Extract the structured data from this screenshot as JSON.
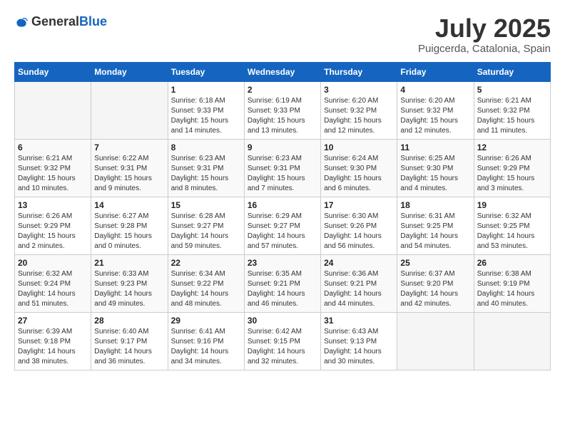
{
  "logo": {
    "text_general": "General",
    "text_blue": "Blue"
  },
  "header": {
    "month": "July 2025",
    "location": "Puigcerda, Catalonia, Spain"
  },
  "weekdays": [
    "Sunday",
    "Monday",
    "Tuesday",
    "Wednesday",
    "Thursday",
    "Friday",
    "Saturday"
  ],
  "weeks": [
    [
      {
        "day": "",
        "sunrise": "",
        "sunset": "",
        "daylight": ""
      },
      {
        "day": "",
        "sunrise": "",
        "sunset": "",
        "daylight": ""
      },
      {
        "day": "1",
        "sunrise": "Sunrise: 6:18 AM",
        "sunset": "Sunset: 9:33 PM",
        "daylight": "Daylight: 15 hours and 14 minutes."
      },
      {
        "day": "2",
        "sunrise": "Sunrise: 6:19 AM",
        "sunset": "Sunset: 9:33 PM",
        "daylight": "Daylight: 15 hours and 13 minutes."
      },
      {
        "day": "3",
        "sunrise": "Sunrise: 6:20 AM",
        "sunset": "Sunset: 9:32 PM",
        "daylight": "Daylight: 15 hours and 12 minutes."
      },
      {
        "day": "4",
        "sunrise": "Sunrise: 6:20 AM",
        "sunset": "Sunset: 9:32 PM",
        "daylight": "Daylight: 15 hours and 12 minutes."
      },
      {
        "day": "5",
        "sunrise": "Sunrise: 6:21 AM",
        "sunset": "Sunset: 9:32 PM",
        "daylight": "Daylight: 15 hours and 11 minutes."
      }
    ],
    [
      {
        "day": "6",
        "sunrise": "Sunrise: 6:21 AM",
        "sunset": "Sunset: 9:32 PM",
        "daylight": "Daylight: 15 hours and 10 minutes."
      },
      {
        "day": "7",
        "sunrise": "Sunrise: 6:22 AM",
        "sunset": "Sunset: 9:31 PM",
        "daylight": "Daylight: 15 hours and 9 minutes."
      },
      {
        "day": "8",
        "sunrise": "Sunrise: 6:23 AM",
        "sunset": "Sunset: 9:31 PM",
        "daylight": "Daylight: 15 hours and 8 minutes."
      },
      {
        "day": "9",
        "sunrise": "Sunrise: 6:23 AM",
        "sunset": "Sunset: 9:31 PM",
        "daylight": "Daylight: 15 hours and 7 minutes."
      },
      {
        "day": "10",
        "sunrise": "Sunrise: 6:24 AM",
        "sunset": "Sunset: 9:30 PM",
        "daylight": "Daylight: 15 hours and 6 minutes."
      },
      {
        "day": "11",
        "sunrise": "Sunrise: 6:25 AM",
        "sunset": "Sunset: 9:30 PM",
        "daylight": "Daylight: 15 hours and 4 minutes."
      },
      {
        "day": "12",
        "sunrise": "Sunrise: 6:26 AM",
        "sunset": "Sunset: 9:29 PM",
        "daylight": "Daylight: 15 hours and 3 minutes."
      }
    ],
    [
      {
        "day": "13",
        "sunrise": "Sunrise: 6:26 AM",
        "sunset": "Sunset: 9:29 PM",
        "daylight": "Daylight: 15 hours and 2 minutes."
      },
      {
        "day": "14",
        "sunrise": "Sunrise: 6:27 AM",
        "sunset": "Sunset: 9:28 PM",
        "daylight": "Daylight: 15 hours and 0 minutes."
      },
      {
        "day": "15",
        "sunrise": "Sunrise: 6:28 AM",
        "sunset": "Sunset: 9:27 PM",
        "daylight": "Daylight: 14 hours and 59 minutes."
      },
      {
        "day": "16",
        "sunrise": "Sunrise: 6:29 AM",
        "sunset": "Sunset: 9:27 PM",
        "daylight": "Daylight: 14 hours and 57 minutes."
      },
      {
        "day": "17",
        "sunrise": "Sunrise: 6:30 AM",
        "sunset": "Sunset: 9:26 PM",
        "daylight": "Daylight: 14 hours and 56 minutes."
      },
      {
        "day": "18",
        "sunrise": "Sunrise: 6:31 AM",
        "sunset": "Sunset: 9:25 PM",
        "daylight": "Daylight: 14 hours and 54 minutes."
      },
      {
        "day": "19",
        "sunrise": "Sunrise: 6:32 AM",
        "sunset": "Sunset: 9:25 PM",
        "daylight": "Daylight: 14 hours and 53 minutes."
      }
    ],
    [
      {
        "day": "20",
        "sunrise": "Sunrise: 6:32 AM",
        "sunset": "Sunset: 9:24 PM",
        "daylight": "Daylight: 14 hours and 51 minutes."
      },
      {
        "day": "21",
        "sunrise": "Sunrise: 6:33 AM",
        "sunset": "Sunset: 9:23 PM",
        "daylight": "Daylight: 14 hours and 49 minutes."
      },
      {
        "day": "22",
        "sunrise": "Sunrise: 6:34 AM",
        "sunset": "Sunset: 9:22 PM",
        "daylight": "Daylight: 14 hours and 48 minutes."
      },
      {
        "day": "23",
        "sunrise": "Sunrise: 6:35 AM",
        "sunset": "Sunset: 9:21 PM",
        "daylight": "Daylight: 14 hours and 46 minutes."
      },
      {
        "day": "24",
        "sunrise": "Sunrise: 6:36 AM",
        "sunset": "Sunset: 9:21 PM",
        "daylight": "Daylight: 14 hours and 44 minutes."
      },
      {
        "day": "25",
        "sunrise": "Sunrise: 6:37 AM",
        "sunset": "Sunset: 9:20 PM",
        "daylight": "Daylight: 14 hours and 42 minutes."
      },
      {
        "day": "26",
        "sunrise": "Sunrise: 6:38 AM",
        "sunset": "Sunset: 9:19 PM",
        "daylight": "Daylight: 14 hours and 40 minutes."
      }
    ],
    [
      {
        "day": "27",
        "sunrise": "Sunrise: 6:39 AM",
        "sunset": "Sunset: 9:18 PM",
        "daylight": "Daylight: 14 hours and 38 minutes."
      },
      {
        "day": "28",
        "sunrise": "Sunrise: 6:40 AM",
        "sunset": "Sunset: 9:17 PM",
        "daylight": "Daylight: 14 hours and 36 minutes."
      },
      {
        "day": "29",
        "sunrise": "Sunrise: 6:41 AM",
        "sunset": "Sunset: 9:16 PM",
        "daylight": "Daylight: 14 hours and 34 minutes."
      },
      {
        "day": "30",
        "sunrise": "Sunrise: 6:42 AM",
        "sunset": "Sunset: 9:15 PM",
        "daylight": "Daylight: 14 hours and 32 minutes."
      },
      {
        "day": "31",
        "sunrise": "Sunrise: 6:43 AM",
        "sunset": "Sunset: 9:13 PM",
        "daylight": "Daylight: 14 hours and 30 minutes."
      },
      {
        "day": "",
        "sunrise": "",
        "sunset": "",
        "daylight": ""
      },
      {
        "day": "",
        "sunrise": "",
        "sunset": "",
        "daylight": ""
      }
    ]
  ]
}
